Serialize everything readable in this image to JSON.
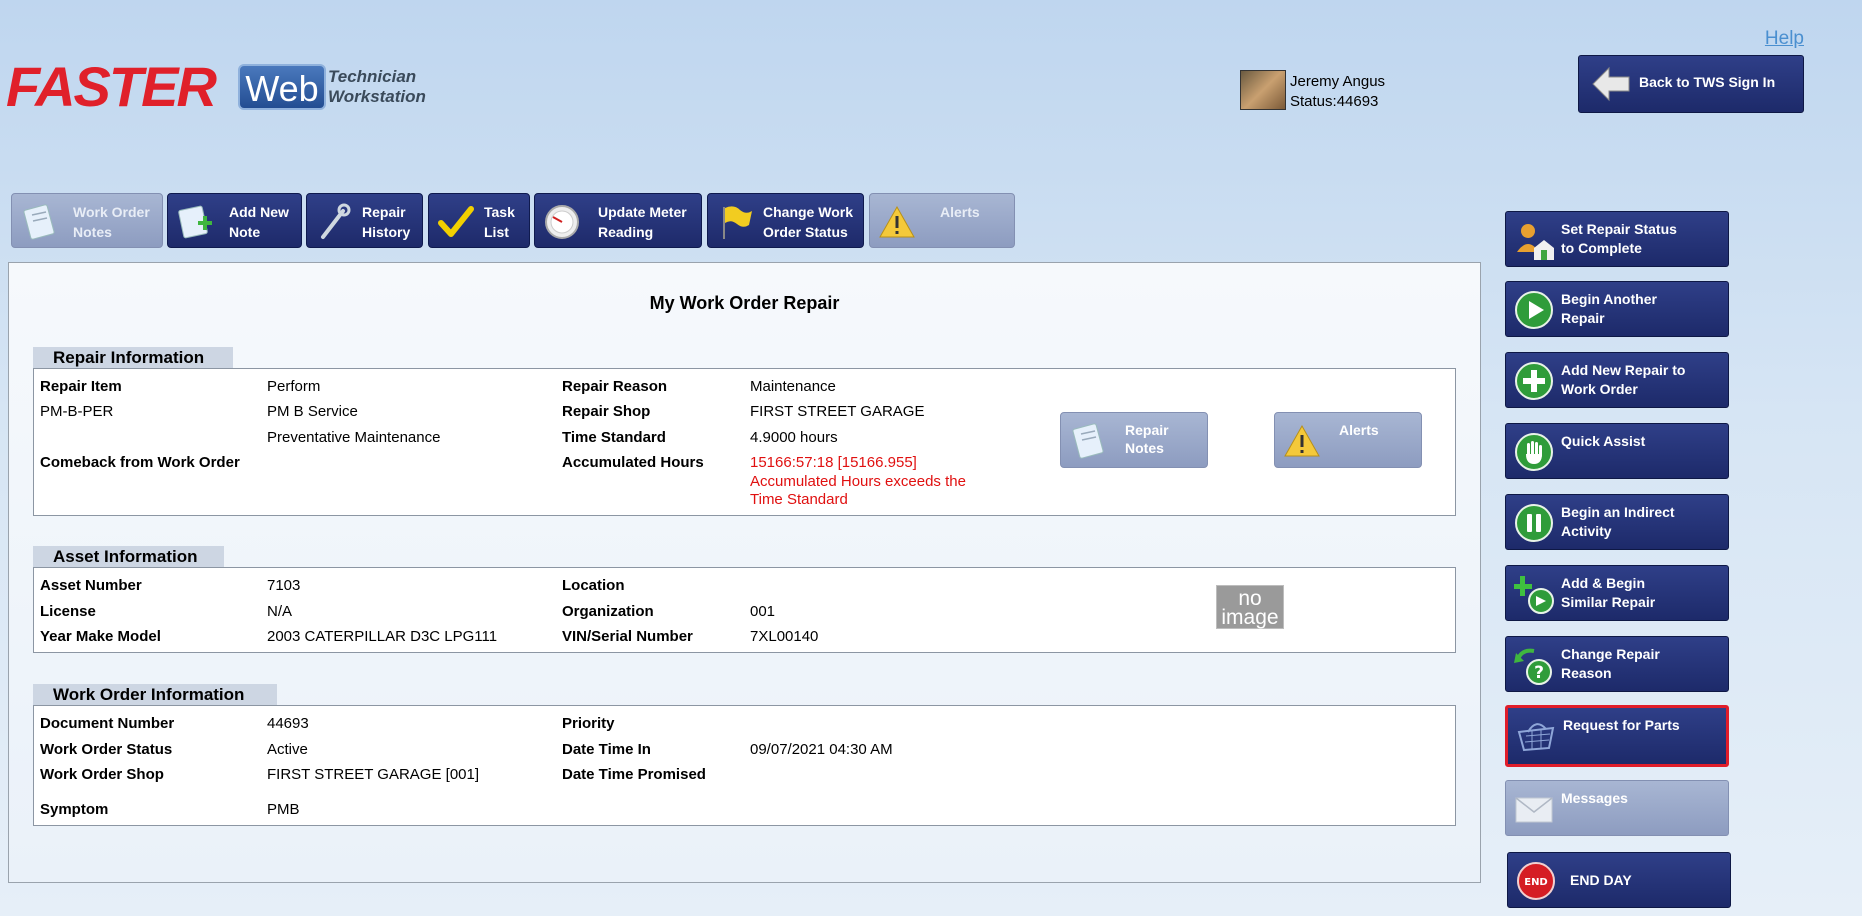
{
  "header": {
    "logo_faster": "FASTER",
    "logo_web": "Web",
    "logo_line1": "Technician",
    "logo_line2": "Workstation",
    "help": "Help",
    "user_name": "Jeremy Angus",
    "user_status": "Status:44693",
    "back_button": "Back to TWS Sign In"
  },
  "tabs": [
    {
      "label": "Work Order\nNotes",
      "icon": "notepad-icon",
      "enabled": false
    },
    {
      "label": "Add New\nNote",
      "icon": "add-note-icon",
      "enabled": true
    },
    {
      "label": "Repair\nHistory",
      "icon": "wrench-icon",
      "enabled": true
    },
    {
      "label": "Task\nList",
      "icon": "checkmark-icon",
      "enabled": true
    },
    {
      "label": "Update Meter\nReading",
      "icon": "gauge-icon",
      "enabled": true
    },
    {
      "label": "Change Work\nOrder Status",
      "icon": "flag-icon",
      "enabled": true
    },
    {
      "label": "Alerts",
      "icon": "warning-icon",
      "enabled": false
    }
  ],
  "main": {
    "title": "My Work Order Repair",
    "repair": {
      "section_title": "Repair Information",
      "repair_item_label": "Repair Item",
      "repair_item_line1": "Perform",
      "repair_code": "PM-B-PER",
      "repair_item_line2": "PM B Service",
      "repair_item_line3": "Preventative Maintenance",
      "comeback_label": "Comeback from Work Order",
      "reason_label": "Repair Reason",
      "reason_value": "Maintenance",
      "shop_label": "Repair Shop",
      "shop_value": "FIRST STREET GARAGE",
      "time_std_label": "Time Standard",
      "time_std_value": "4.9000 hours",
      "accum_label": "Accumulated Hours",
      "accum_value": "15166:57:18 [15166.955]",
      "accum_warning_line1": "Accumulated Hours exceeds the",
      "accum_warning_line2": "Time Standard",
      "repair_notes_button": "Repair\nNotes",
      "alerts_button": "Alerts"
    },
    "asset": {
      "section_title": "Asset Information",
      "asset_number_label": "Asset Number",
      "asset_number_value": "7103",
      "license_label": "License",
      "license_value": "N/A",
      "ymm_label": "Year Make Model",
      "ymm_value": "2003 CATERPILLAR D3C LPG111",
      "location_label": "Location",
      "organization_label": "Organization",
      "organization_value": "001",
      "vin_label": "VIN/Serial Number",
      "vin_value": "7XL00140",
      "no_image_line1": "no",
      "no_image_line2": "image"
    },
    "work_order": {
      "section_title": "Work Order Information",
      "doc_label": "Document Number",
      "doc_value": "44693",
      "status_label": "Work Order Status",
      "status_value": "Active",
      "shop_label": "Work Order Shop",
      "shop_value": "FIRST STREET GARAGE [001]",
      "symptom_label": "Symptom",
      "symptom_value": "PMB",
      "priority_label": "Priority",
      "date_in_label": "Date Time In",
      "date_in_value": "09/07/2021 04:30 AM",
      "date_promised_label": "Date Time Promised"
    }
  },
  "sidebar": [
    {
      "label": "Set Repair Status\nto Complete",
      "icon": "complete-status-icon",
      "enabled": true
    },
    {
      "label": "Begin Another\nRepair",
      "icon": "play-icon",
      "enabled": true
    },
    {
      "label": "Add New Repair to\nWork Order",
      "icon": "plus-icon",
      "enabled": true
    },
    {
      "label": "Quick Assist",
      "icon": "hand-icon",
      "enabled": true
    },
    {
      "label": "Begin an Indirect\nActivity",
      "icon": "pause-icon",
      "enabled": true
    },
    {
      "label": "Add & Begin\nSimilar Repair",
      "icon": "add-begin-icon",
      "enabled": true
    },
    {
      "label": "Change Repair\nReason",
      "icon": "question-icon",
      "enabled": true
    },
    {
      "label": "Request for Parts",
      "icon": "basket-icon",
      "enabled": true,
      "selected": true
    },
    {
      "label": "Messages",
      "icon": "envelope-icon",
      "enabled": false
    },
    {
      "label": "END DAY",
      "icon": "end-icon",
      "enabled": true
    }
  ],
  "colors": {
    "button_navy": "#24317a",
    "button_disabled": "#9aa8c8",
    "warning_red": "#e01010",
    "selected_border": "#e01d2a",
    "logo_red": "#e0202a"
  }
}
